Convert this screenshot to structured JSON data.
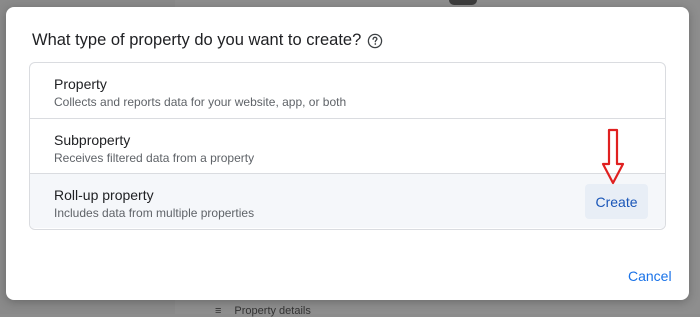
{
  "dialog": {
    "title": "What type of property do you want to create?",
    "options": [
      {
        "title": "Property",
        "description": "Collects and reports data for your website, app, or both"
      },
      {
        "title": "Subproperty",
        "description": "Receives filtered data from a property"
      },
      {
        "title": "Roll-up property",
        "description": "Includes data from multiple properties"
      }
    ],
    "create_label": "Create",
    "cancel_label": "Cancel"
  },
  "background": {
    "bottom_text": "Property details"
  },
  "colors": {
    "accent": "#1a73e8",
    "annotation": "#e02020"
  }
}
